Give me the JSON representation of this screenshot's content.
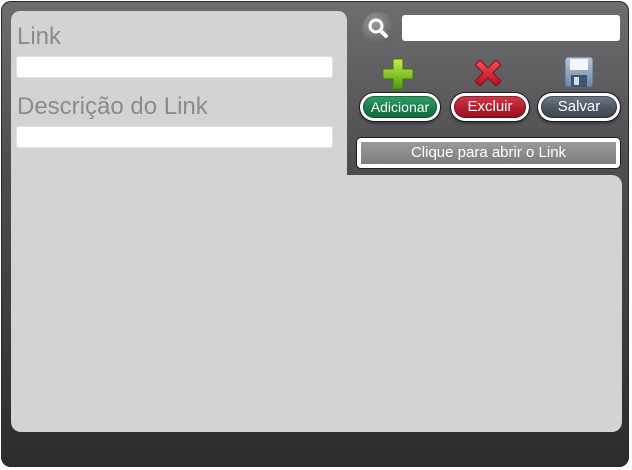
{
  "form": {
    "link_label": "Link",
    "link_value": "",
    "description_label": "Descrição do Link",
    "description_value": ""
  },
  "search": {
    "icon": "search-icon",
    "value": ""
  },
  "actions": {
    "add": {
      "icon": "plus-icon",
      "label": "Adicionar",
      "color": "#1a7d4b"
    },
    "delete": {
      "icon": "x-icon",
      "label": "Excluir",
      "color": "#b21d2c"
    },
    "save": {
      "icon": "floppy-disk-icon",
      "label": "Salvar",
      "color": "#4d5764"
    }
  },
  "open_link": {
    "label": "Clique para abrir o Link"
  },
  "theme": {
    "panel": "#d2d3d5",
    "frame": "#4e4e50",
    "label_text": "#8a8b8d"
  }
}
